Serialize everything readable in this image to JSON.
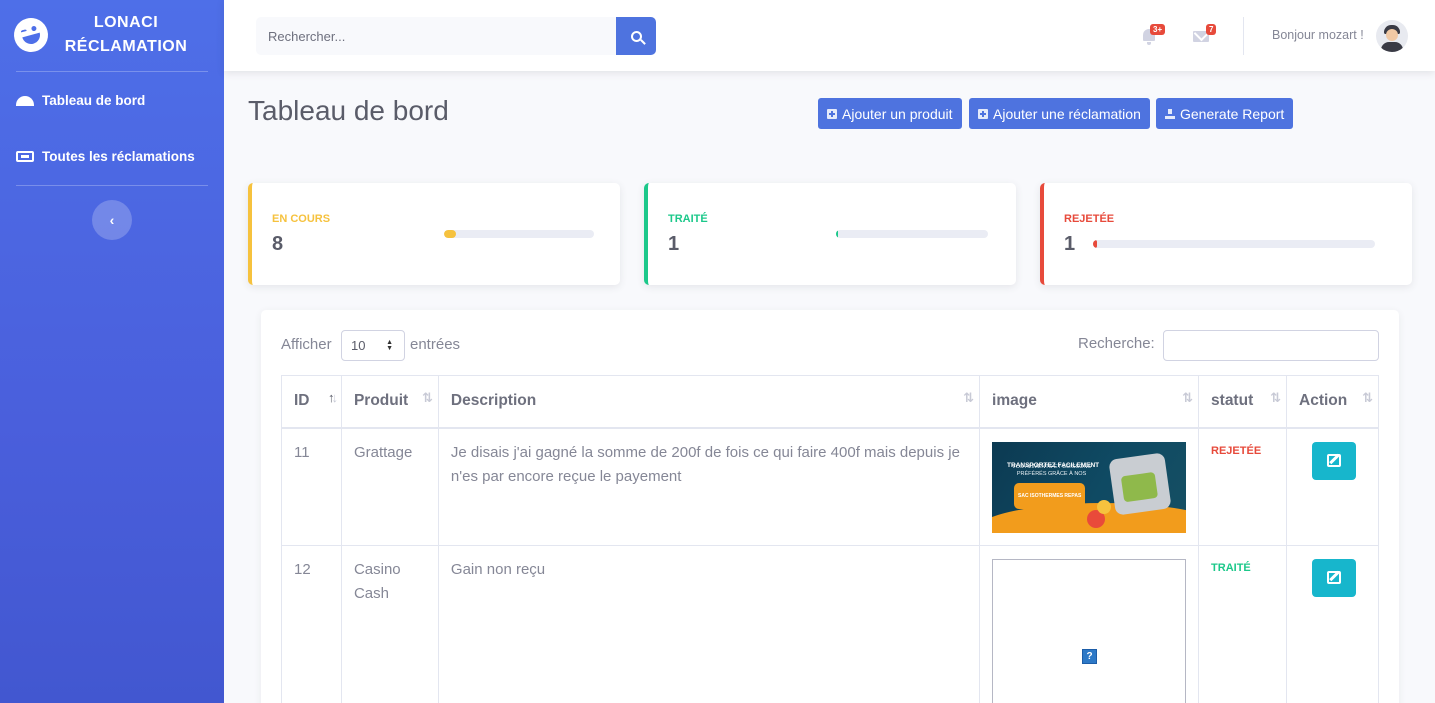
{
  "brand": {
    "line1": "LONACI",
    "line2": "RÉCLAMATION"
  },
  "sidebar": {
    "items": [
      {
        "label": "Tableau de bord",
        "icon": "tachometer-icon"
      },
      {
        "label": "Toutes les réclamations",
        "icon": "ticket-icon"
      }
    ],
    "toggle_glyph": "‹"
  },
  "topbar": {
    "search_placeholder": "Rechercher...",
    "alerts_badge": "3+",
    "messages_badge": "7",
    "greeting": "Bonjour mozart !"
  },
  "page": {
    "title": "Tableau de bord",
    "buttons": {
      "add_product": "Ajouter un produit",
      "add_claim": "Ajouter une réclamation",
      "report": "Generate Report"
    }
  },
  "stats": [
    {
      "label": "EN COURS",
      "value": "8",
      "progress": 0.08,
      "color": "#f6c23e"
    },
    {
      "label": "TRAITÉ",
      "value": "1",
      "progress": 0.01,
      "color": "#1cc88a"
    },
    {
      "label": "REJETÉE",
      "value": "1",
      "progress": 0.01,
      "color": "#e74a3b"
    }
  ],
  "table": {
    "length_prefix": "Afficher",
    "length_value": "10",
    "length_suffix": "entrées",
    "filter_label": "Recherche:",
    "headers": [
      "ID",
      "Produit",
      "Description",
      "image",
      "statut",
      "Action"
    ],
    "sort_glyph": "⇅",
    "rows": [
      {
        "id": "11",
        "product": "Grattage",
        "description": "Je disais j'ai gagné la somme de 200f de fois ce qui faire 400f mais depuis je n'es par encore reçue le payement",
        "image": {
          "headline": "TRANSPORTEZ FACILEMENT",
          "subline1": "VOS ALIMENTS ET BOISSONS",
          "subline2": "PRÉFÉRÉS GRÂCE À NOS",
          "tag": "SAC ISOTHERMES REPAS"
        },
        "status": "REJETÉE",
        "status_color": "#e74a3b"
      },
      {
        "id": "12",
        "product": "Casino Cash",
        "description": "Gain non reçu",
        "image_broken_glyph": "?",
        "status": "TRAITÉ",
        "status_color": "#1cc88a"
      }
    ]
  }
}
